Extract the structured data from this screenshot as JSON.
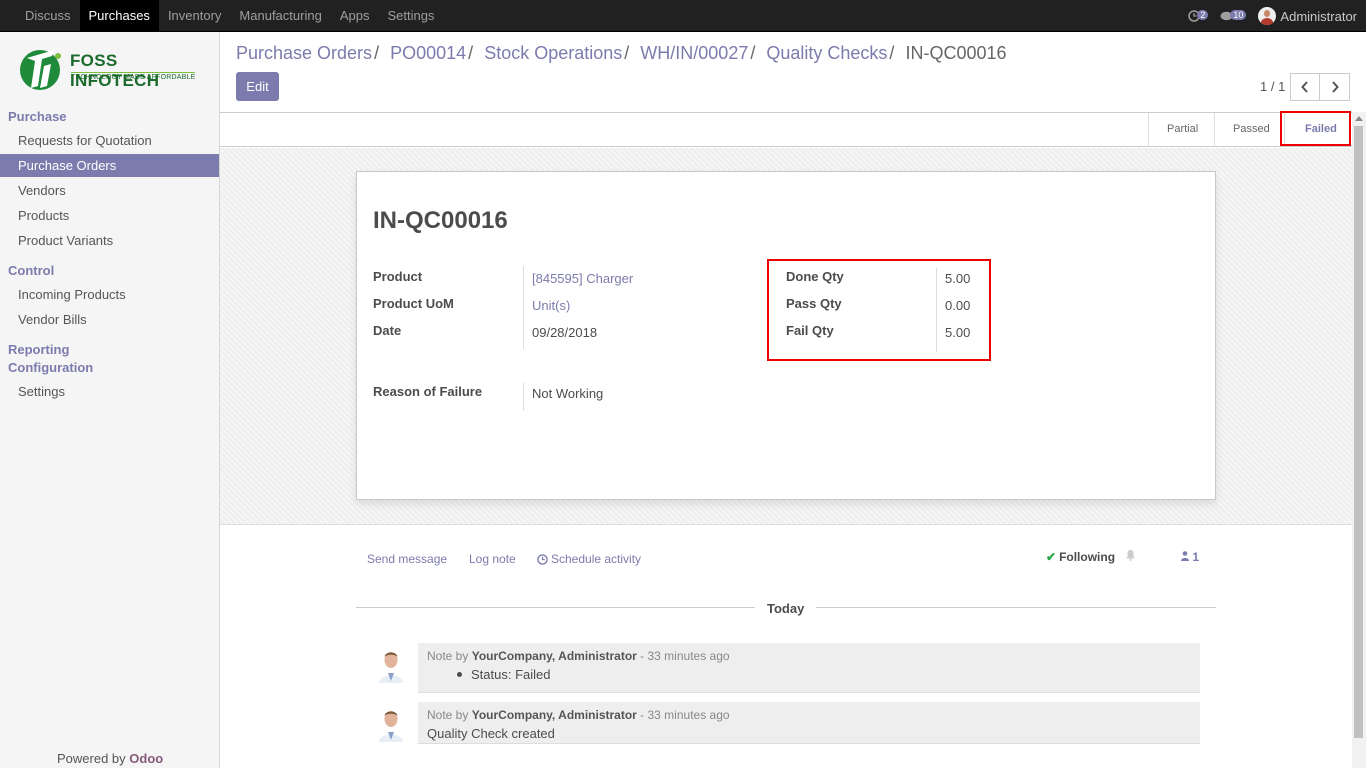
{
  "topbar": {
    "menu": [
      "Discuss",
      "Purchases",
      "Inventory",
      "Manufacturing",
      "Apps",
      "Settings"
    ],
    "activity_count": "2",
    "message_count": "10",
    "user_name": "Administrator"
  },
  "sidebar": {
    "logo_name": "FOSS INFOTECH",
    "logo_tagline": "TECHNOLOGY MADE AFFORDABLE",
    "sections": {
      "purchase": "Purchase",
      "control": "Control",
      "reporting": "Reporting",
      "configuration": "Configuration"
    },
    "items": {
      "rfq": "Requests for Quotation",
      "purchase_orders": "Purchase Orders",
      "vendors": "Vendors",
      "products": "Products",
      "product_variants": "Product Variants",
      "incoming_products": "Incoming Products",
      "vendor_bills": "Vendor Bills",
      "settings": "Settings"
    },
    "powered_prefix": "Powered by",
    "powered_brand": "Odoo"
  },
  "breadcrumb": [
    "Purchase Orders",
    "PO00014",
    "Stock Operations",
    "WH/IN/00027",
    "Quality Checks",
    "IN-QC00016"
  ],
  "breadcrumb_sep": "/",
  "control": {
    "edit_label": "Edit",
    "pager": "1 / 1"
  },
  "stages": [
    "Partial",
    "Passed",
    "Failed"
  ],
  "record": {
    "title": "IN-QC00016",
    "product_label": "Product",
    "product_value": "[845595] Charger",
    "uom_label": "Product UoM",
    "uom_value": "Unit(s)",
    "date_label": "Date",
    "date_value": "09/28/2018",
    "done_qty_label": "Done Qty",
    "done_qty_value": "5.00",
    "pass_qty_label": "Pass Qty",
    "pass_qty_value": "0.00",
    "fail_qty_label": "Fail Qty",
    "fail_qty_value": "5.00",
    "reason_label": "Reason of Failure",
    "reason_value": "Not Working"
  },
  "chatter": {
    "send_message": "Send message",
    "log_note": "Log note",
    "schedule_activity": "Schedule activity",
    "following": "Following",
    "followers_count": "1",
    "today": "Today",
    "messages": [
      {
        "prefix": "Note by",
        "author": "YourCompany, Administrator",
        "time": "- 33 minutes ago",
        "body": "Status: Failed"
      },
      {
        "prefix": "Note by",
        "author": "YourCompany, Administrator",
        "time": "- 33 minutes ago",
        "body": "Quality Check created"
      }
    ]
  },
  "colors": {
    "accent": "#7c7bad",
    "topbar": "#212121",
    "highlight": "#ee0000"
  }
}
